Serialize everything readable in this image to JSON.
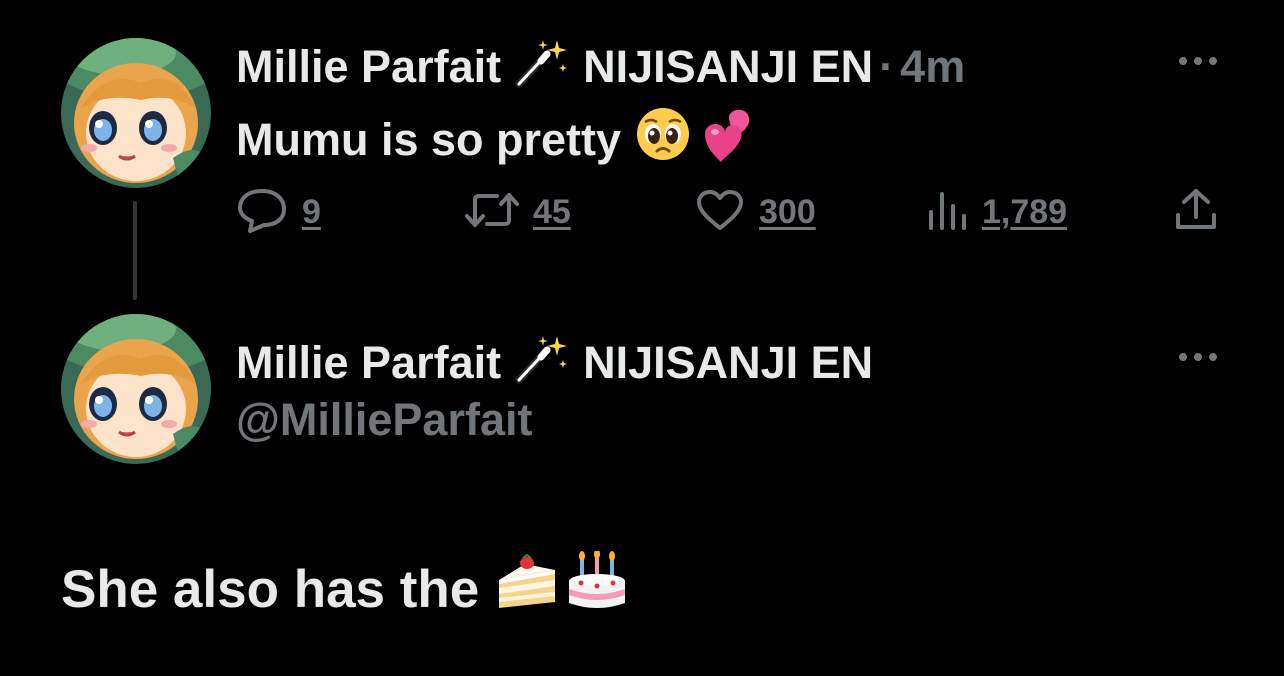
{
  "tweet": {
    "author": {
      "display_name": "Millie Parfait",
      "affiliation": "NIJISANJI EN",
      "emoji_icon": "magic-wand-icon"
    },
    "separator": "·",
    "time": "4m",
    "text": "Mumu is so pretty",
    "text_emojis": [
      "pleading-face-emoji",
      "two-hearts-emoji"
    ],
    "actions": {
      "replies": "9",
      "retweets": "45",
      "likes": "300",
      "views": "1,789"
    }
  },
  "reply": {
    "author": {
      "display_name": "Millie Parfait",
      "affiliation": "NIJISANJI EN",
      "handle": "@MillieParfait",
      "emoji_icon": "magic-wand-icon"
    },
    "text": "She also has the",
    "text_emojis": [
      "shortcake-emoji",
      "birthday-cake-emoji"
    ]
  },
  "colors": {
    "background": "#000000",
    "primary_text": "#e7e9ea",
    "secondary_text": "#71767b",
    "thread_line": "#333639"
  }
}
